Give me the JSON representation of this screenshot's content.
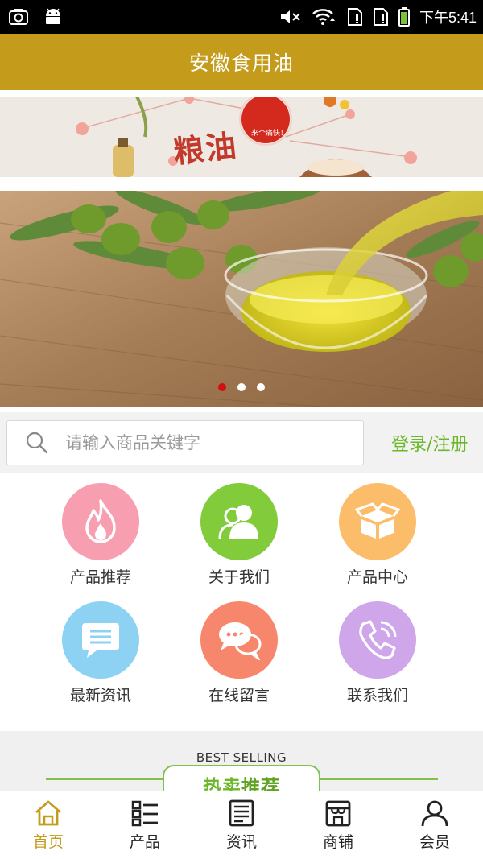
{
  "status_bar": {
    "time": "下午5:41",
    "icons": [
      "screenshot-icon",
      "android-icon",
      "mute-icon",
      "wifi-icon",
      "sim1-icon",
      "sim2-icon",
      "battery-icon"
    ]
  },
  "header": {
    "title": "安徽食用油"
  },
  "promo_banner": {
    "headline": "粮油",
    "badge_text": "来个痛快！"
  },
  "hero": {
    "slide_count": 3,
    "active_index": 0
  },
  "search": {
    "placeholder": "请输入商品关键字",
    "value": "",
    "login_label": "登录/注册"
  },
  "grid": {
    "items": [
      {
        "label": "产品推荐",
        "icon": "flame-icon",
        "color": "#f79eb0"
      },
      {
        "label": "关于我们",
        "icon": "users-icon",
        "color": "#82cc3c"
      },
      {
        "label": "产品中心",
        "icon": "box-icon",
        "color": "#fbbd6a"
      },
      {
        "label": "最新资讯",
        "icon": "message-icon",
        "color": "#8ed2f3"
      },
      {
        "label": "在线留言",
        "icon": "chat-icon",
        "color": "#f6876c"
      },
      {
        "label": "联系我们",
        "icon": "phone-icon",
        "color": "#cfa6ea"
      }
    ]
  },
  "best_selling": {
    "en": "BEST SELLING",
    "cn_prefix": "热卖",
    "cn_suffix": "推荐"
  },
  "bottom_nav": {
    "items": [
      {
        "label": "首页",
        "icon": "home-icon",
        "active": true
      },
      {
        "label": "产品",
        "icon": "list-icon",
        "active": false
      },
      {
        "label": "资讯",
        "icon": "news-icon",
        "active": false
      },
      {
        "label": "商铺",
        "icon": "store-icon",
        "active": false
      },
      {
        "label": "会员",
        "icon": "user-icon",
        "active": false
      }
    ]
  },
  "colors": {
    "accent": "#c49b1a",
    "green": "#6bb82a",
    "active_dot": "#d40f0f"
  }
}
